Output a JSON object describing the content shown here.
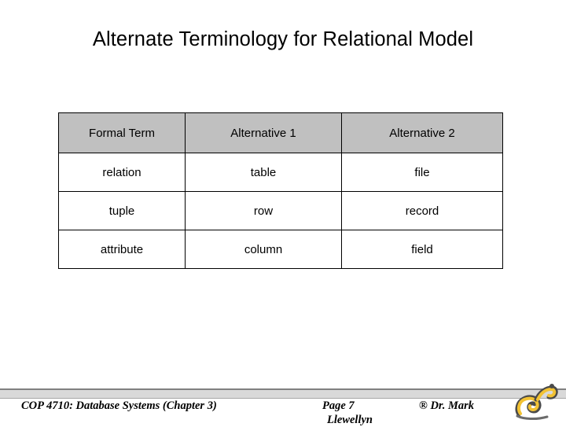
{
  "slide": {
    "title": "Alternate Terminology for Relational Model"
  },
  "table": {
    "headers": [
      "Formal Term",
      "Alternative 1",
      "Alternative 2"
    ],
    "rows": [
      [
        "relation",
        "table",
        "file"
      ],
      [
        "tuple",
        "row",
        "record"
      ],
      [
        "attribute",
        "column",
        "field"
      ]
    ],
    "header_bg": "#c0c0c0",
    "border_color": "#000000"
  },
  "footer": {
    "left": "COP 4710: Database Systems  (Chapter 3)",
    "center": "Page  7",
    "right": "® Dr. Mark",
    "wrapped": "Llewellyn",
    "logo_name": "snail-logo"
  }
}
